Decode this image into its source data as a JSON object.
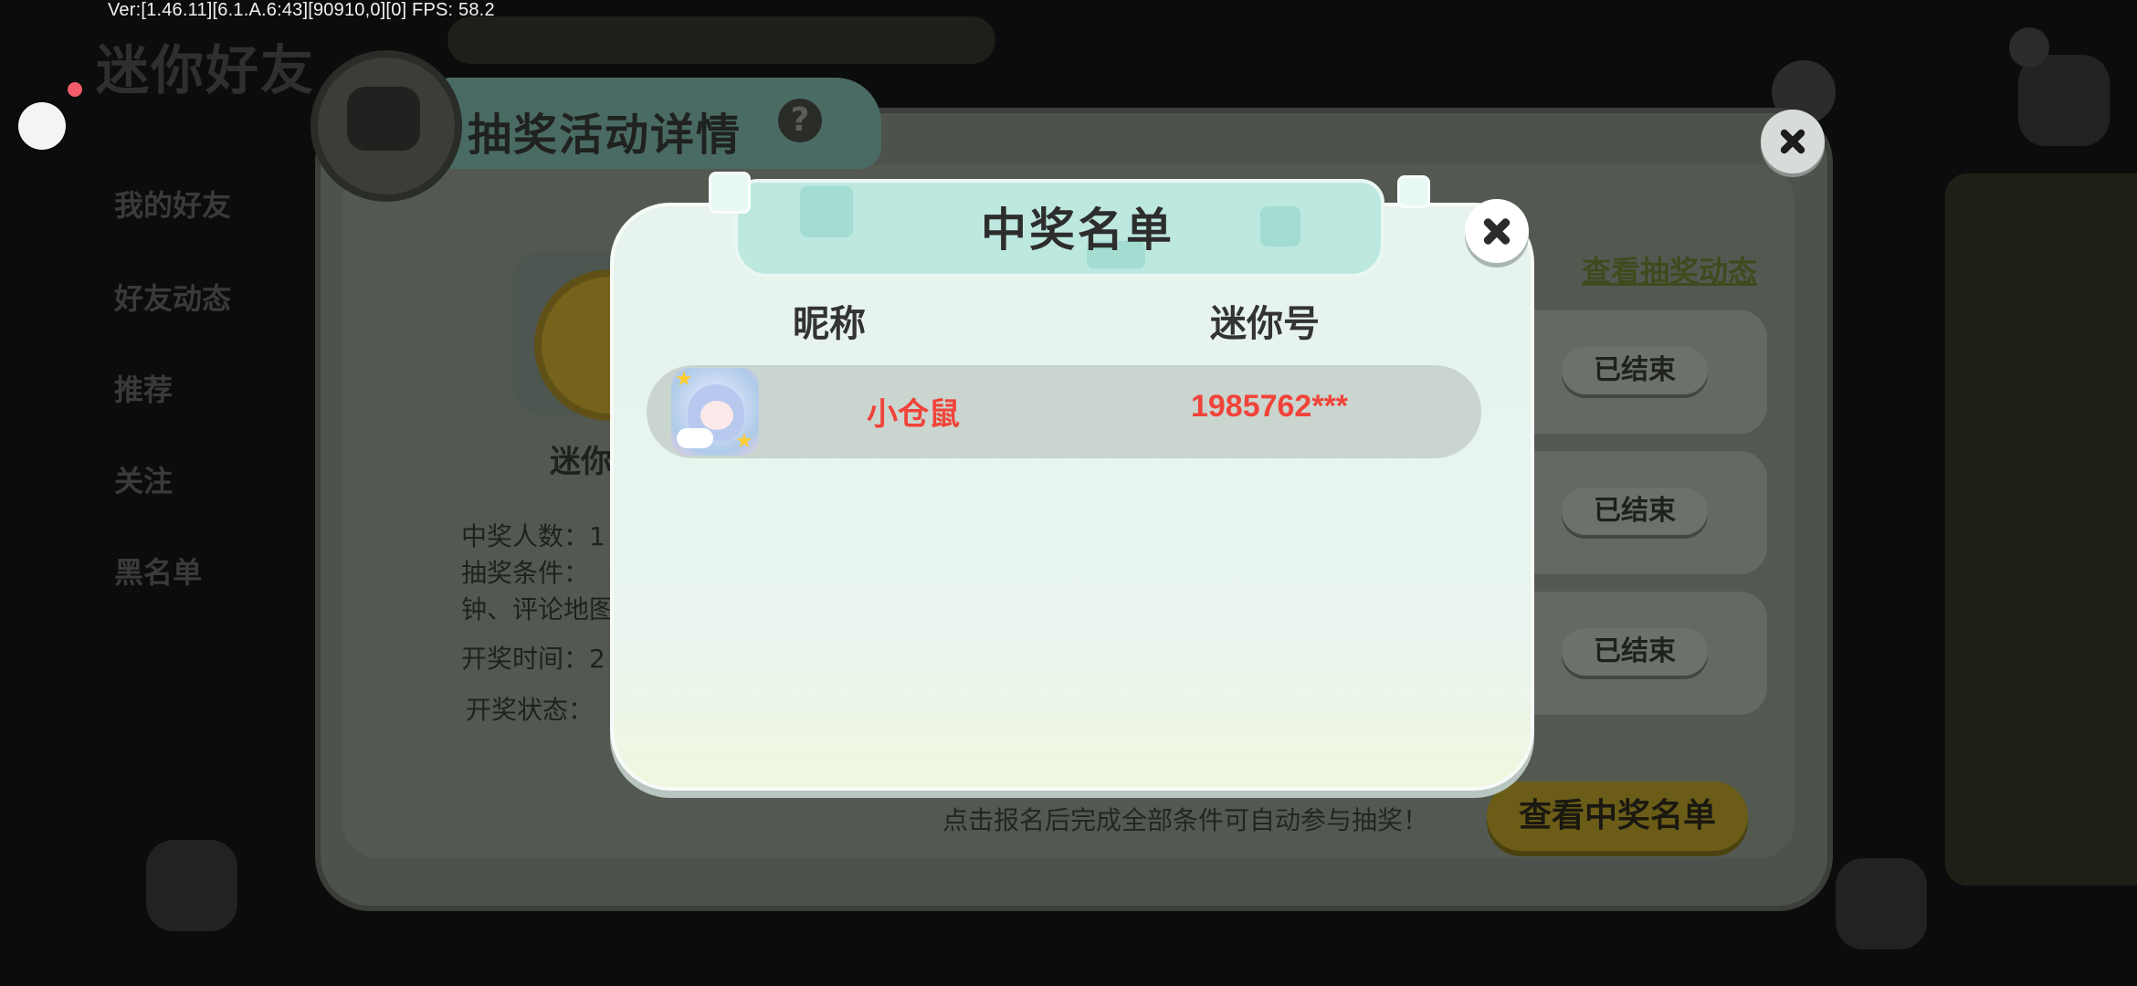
{
  "debug": {
    "version_text": "Ver:[1.46.11][6.1.A.6:43][90910,0][0] FPS: 58.2"
  },
  "background_app": {
    "title": "迷你好友",
    "menu": [
      "我的好友",
      "好友动态",
      "推荐",
      "关注",
      "黑名单"
    ]
  },
  "lottery_detail": {
    "title": "抽奖活动详情",
    "help_icon": "question-circle-icon",
    "prize_name": "迷你",
    "info_lines": [
      "中奖人数：1",
      "抽奖条件：",
      "钟、评论地图",
      "开奖时间：2",
      "开奖状态："
    ],
    "view_dynamic_link": "查看抽奖动态",
    "ended_labels": [
      "已结束",
      "已结束",
      "已结束"
    ],
    "bottom_tip": "点击报名后完成全部条件可自动参与抽奖！",
    "winners_button": "查看中奖名单"
  },
  "winners_popup": {
    "title": "中奖名单",
    "columns": {
      "nickname": "昵称",
      "mini_id": "迷你号"
    },
    "rows": [
      {
        "avatar": "anime-avatar-icon",
        "nickname": "小仓鼠",
        "mini_id": "1985762***"
      }
    ],
    "highlight_color": "#f0433a"
  }
}
